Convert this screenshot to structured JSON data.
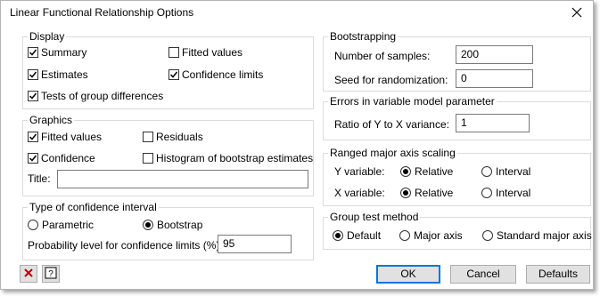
{
  "window": {
    "title": "Linear Functional Relationship Options"
  },
  "display": {
    "label": "Display",
    "summary": "Summary",
    "fitted_values": "Fitted values",
    "estimates": "Estimates",
    "confidence_limits": "Confidence limits",
    "tests": "Tests of group differences"
  },
  "graphics": {
    "label": "Graphics",
    "fitted_values": "Fitted values",
    "residuals": "Residuals",
    "confidence": "Confidence",
    "histogram": "Histogram of bootstrap estimates",
    "title_label": "Title:",
    "title_value": ""
  },
  "ci_type": {
    "label": "Type of confidence interval",
    "parametric": "Parametric",
    "bootstrap": "Bootstrap",
    "prob_label": "Probability level for confidence limits (%):",
    "prob_value": "95"
  },
  "bootstrapping": {
    "label": "Bootstrapping",
    "samples_label": "Number of samples:",
    "samples_value": "200",
    "seed_label": "Seed for randomization:",
    "seed_value": "0"
  },
  "errors": {
    "label": "Errors in variable model parameter",
    "ratio_label": "Ratio of Y to X variance:",
    "ratio_value": "1"
  },
  "rma": {
    "label": "Ranged major axis scaling",
    "y_label": "Y variable:",
    "x_label": "X variable:",
    "relative": "Relative",
    "interval": "Interval"
  },
  "group_test": {
    "label": "Group test method",
    "default": "Default",
    "major_axis": "Major axis",
    "standard_major_axis": "Standard major axis"
  },
  "buttons": {
    "ok": "OK",
    "cancel": "Cancel",
    "defaults": "Defaults"
  }
}
